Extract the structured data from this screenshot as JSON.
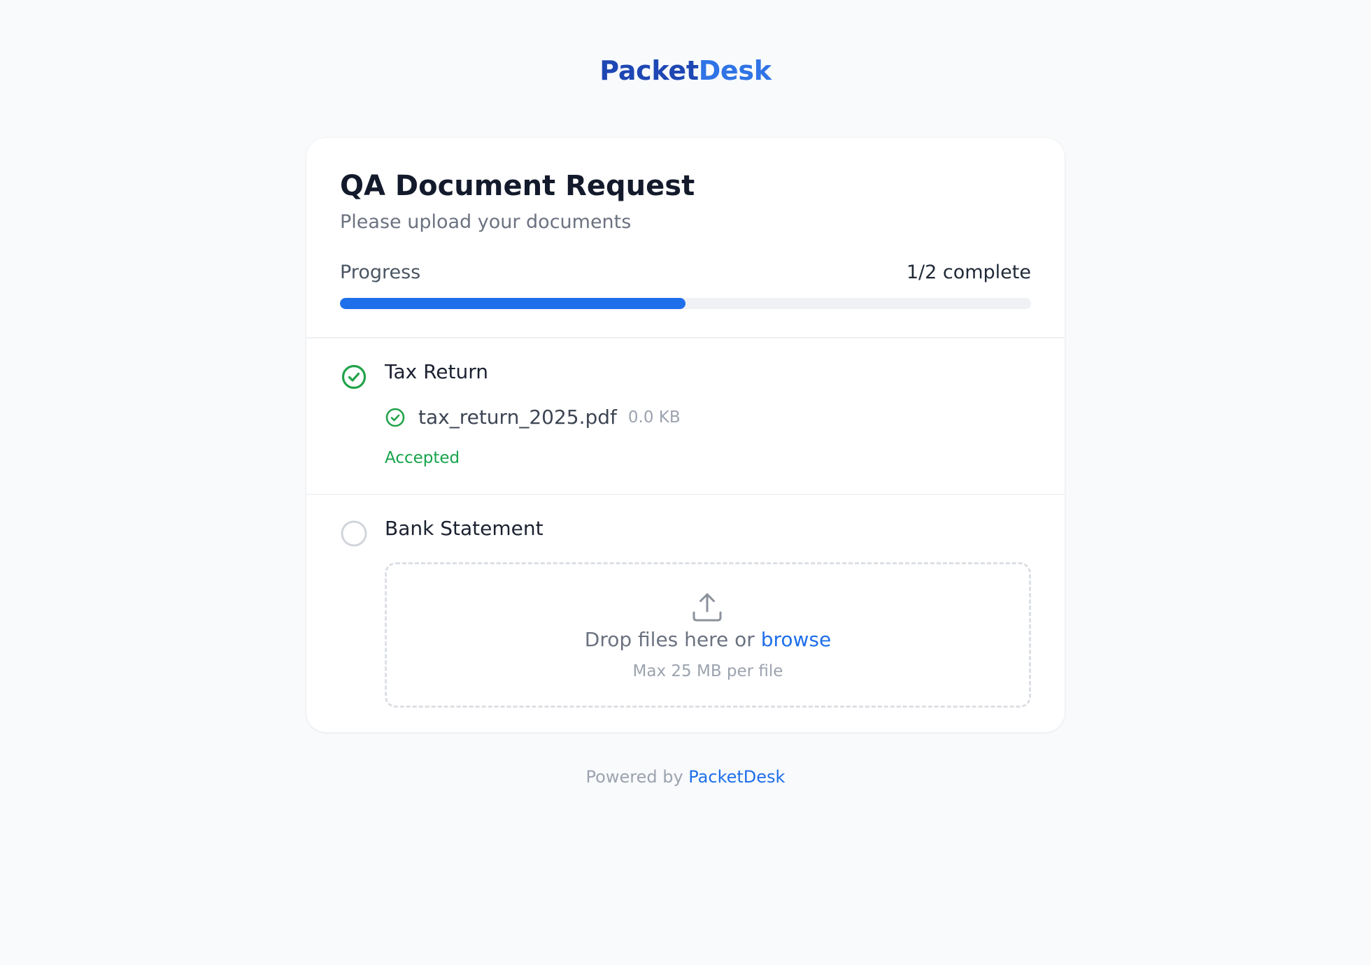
{
  "brand": {
    "part1": "Packet",
    "part2": "Desk",
    "color_dark": "#1e47b4",
    "color_light": "#2f73e6"
  },
  "request": {
    "title": "QA Document Request",
    "subtitle": "Please upload your documents"
  },
  "progress": {
    "label": "Progress",
    "count_text": "1/2 complete",
    "completed": 1,
    "total": 2,
    "fraction": 0.5,
    "fill_color": "#1f6fea"
  },
  "items": [
    {
      "name": "Tax Return",
      "status_icon": "check-circle-icon",
      "status_color": "#22a34a",
      "file": {
        "name": "tax_return_2025.pdf",
        "size": "0.0 KB",
        "icon": "check-circle-icon"
      },
      "status_text": "Accepted"
    },
    {
      "name": "Bank Statement",
      "status_icon": "empty-circle-icon",
      "status_color": "#d1d5db",
      "dropzone": {
        "icon": "upload-icon",
        "text": "Drop files here or ",
        "browse_label": "browse",
        "hint": "Max 25 MB per file"
      }
    }
  ],
  "footer": {
    "prefix": "Powered by ",
    "link": "PacketDesk"
  }
}
